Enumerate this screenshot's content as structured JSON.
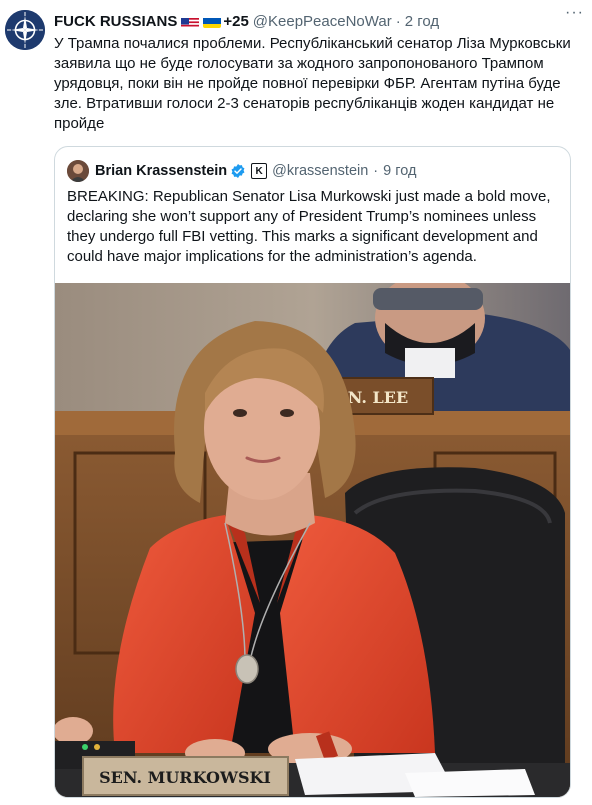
{
  "tweet": {
    "author_name": "FUCK RUSSIANS",
    "flags": [
      "us-flag",
      "ukraine-flag"
    ],
    "extra_emoji": "+25",
    "handle": "@KeepPeaceNoWar",
    "separator": "·",
    "time": "2 год",
    "more": "···",
    "text": "У Трампа почалися проблеми. Республіканський сенатор Ліза Мурковськи заявила що не буде голосувати за жодного запропонованого Трампом урядовця, поки він не пройде повної перевірки ФБР. Агентам путіна буде зле. Втративши голоси 2-3 сенаторів республіканців жоден кандидат не пройде"
  },
  "quote": {
    "author_name": "Brian Krassenstein",
    "handle": "@krassenstein",
    "separator": "·",
    "time": "9 год",
    "k_icon": "K",
    "text": "BREAKING: Republican Senator Lisa Murkowski just made a bold move, declaring she won’t support any of President Trump’s nominees unless they undergo full FBI vetting. This marks a significant development and could have major implications for the administration’s agenda.",
    "photo": {
      "background_nameplate": "N. LEE",
      "front_nameplate": "SEN. MURKOWSKI"
    }
  },
  "colors": {
    "text": "#0f1419",
    "secondary": "#536471",
    "border": "#cfd9de",
    "verified": "#1d9bf0",
    "blazer": "#e0452f"
  }
}
